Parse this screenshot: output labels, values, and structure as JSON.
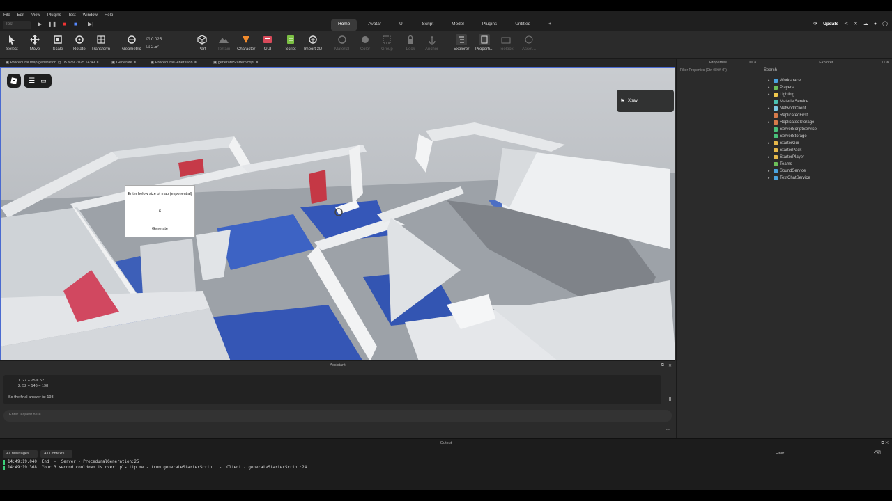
{
  "menu": [
    "File",
    "Edit",
    "View",
    "Plugins",
    "Test",
    "Window",
    "Help"
  ],
  "ribbon_top": {
    "test_select": "Test",
    "main_tabs": [
      "Home",
      "Avatar",
      "UI",
      "Script",
      "Model",
      "Plugins",
      "Untitled"
    ],
    "active_tab": "Home",
    "update_label": "Update"
  },
  "tools": {
    "select": "Select",
    "move": "Move",
    "scale": "Scale",
    "rotate": "Rotate",
    "transform": "Transform",
    "geometric": "Geometric",
    "move_snap": "0.025...",
    "rotate_snap": "2.5°",
    "part": "Part",
    "terrain": "Terrain",
    "character": "Character",
    "gui": "GUI",
    "script": "Script",
    "import3d": "Import 3D",
    "material": "Material",
    "color": "Color",
    "group": "Group",
    "lock": "Lock",
    "anchor": "Anchor",
    "explorer": "Explorer",
    "properties": "Properti...",
    "toolbox": "Toolbox",
    "asset": "Asset..."
  },
  "doc_tabs": [
    "Procedural map generation @ 05 Nov 2025 14:49",
    "Generate",
    "ProceduralGeneration",
    "generateStarterScript"
  ],
  "viewport": {
    "player_name": "Xtrav",
    "dialog_title": "Enter below size of map (exponential)",
    "dialog_value": "6",
    "dialog_button": "Generate"
  },
  "assistant": {
    "title": "Assistant",
    "lines": [
      "1. 27 + 25 = 52",
      "2. 52 + 146 = 198",
      "So the final answer is: 198"
    ],
    "input_placeholder": "Enter request here",
    "more": "..."
  },
  "output": {
    "title": "Output",
    "filter_messages": "All Messages",
    "filter_contexts": "All Contexts",
    "filter_search": "Filter...",
    "logs": [
      "14:49:19.040  End  -  Server - ProceduralGeneration:25",
      "14:49:19.368  Your 3 second cooldown is over! pls tip me - from generateStarterScript  -  Client - generateStarterScript:24"
    ]
  },
  "properties": {
    "title": "Properties",
    "filter": "Filter Properties (Ctrl+Shift+P)"
  },
  "explorer": {
    "title": "Explorer",
    "search": "Search",
    "items": [
      "Workspace",
      "Players",
      "Lighting",
      "MaterialService",
      "NetworkClient",
      "ReplicatedFirst",
      "ReplicatedStorage",
      "ServerScriptService",
      "ServerStorage",
      "StarterGui",
      "StarterPack",
      "StarterPlayer",
      "Teams",
      "SoundService",
      "TextChatService"
    ]
  },
  "colors": {
    "accent": "#4a6ad0",
    "log_marker": "#3bd07a",
    "dark_bg": "#2b2b2b"
  }
}
